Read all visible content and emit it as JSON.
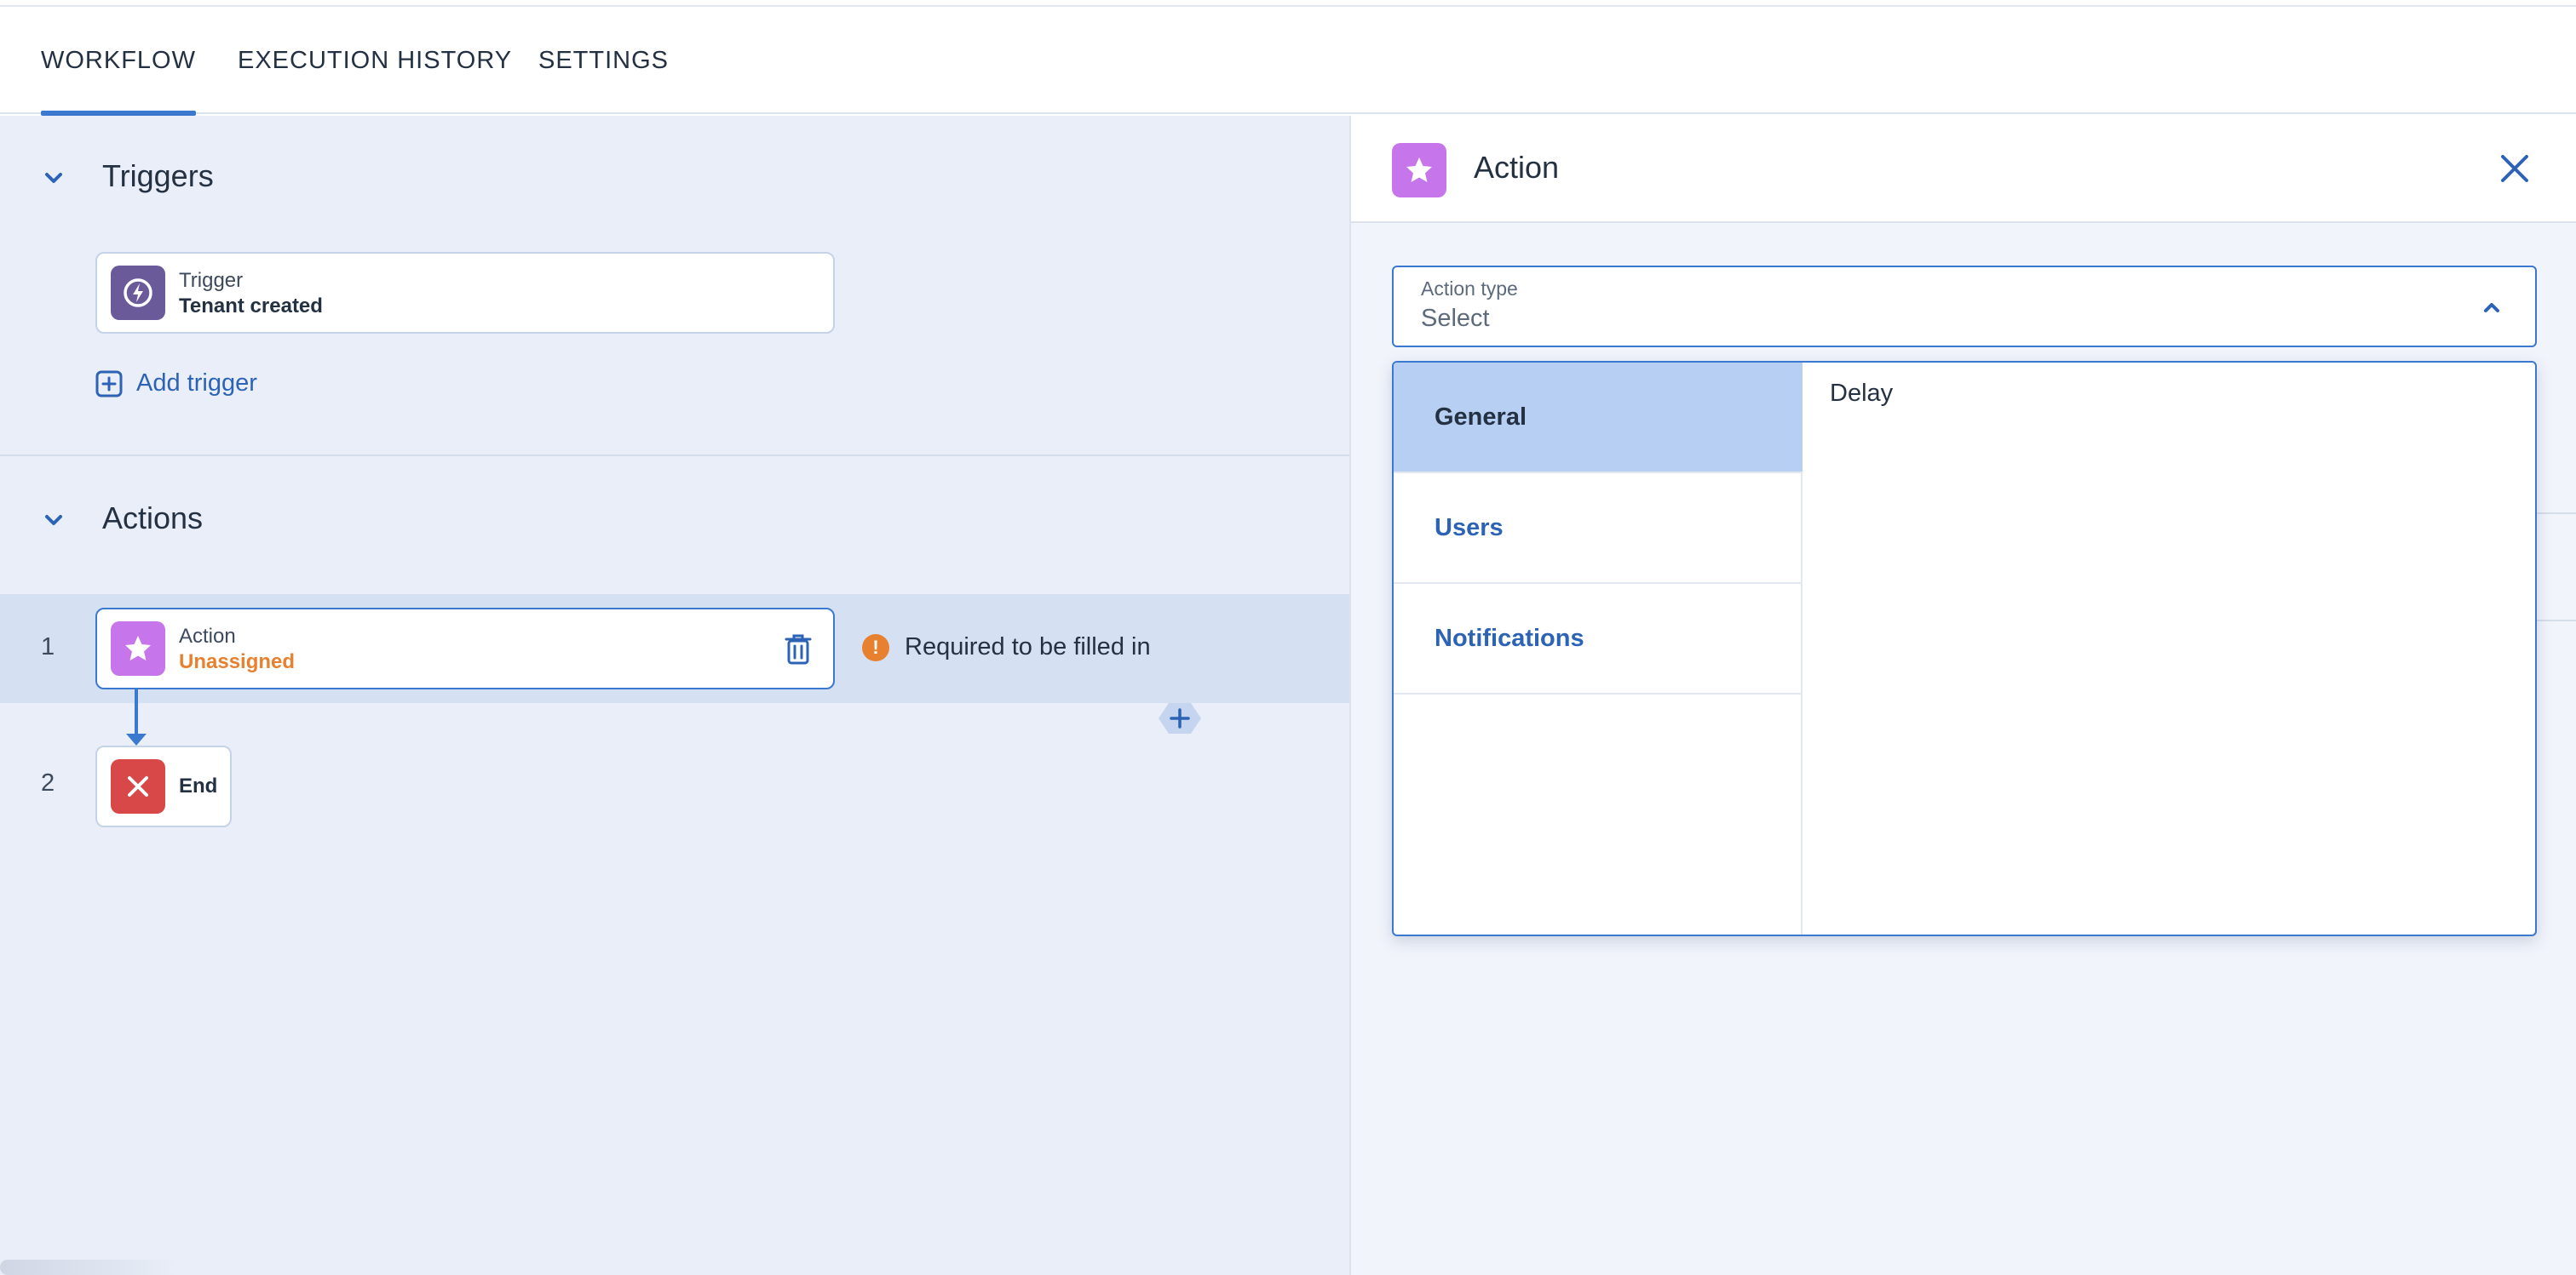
{
  "tabs": [
    {
      "label": "WORKFLOW",
      "active": true
    },
    {
      "label": "EXECUTION HISTORY",
      "active": false
    },
    {
      "label": "SETTINGS",
      "active": false
    }
  ],
  "triggers": {
    "title": "Triggers",
    "card": {
      "label": "Trigger",
      "value": "Tenant created"
    },
    "add_label": "Add trigger"
  },
  "actions": {
    "title": "Actions",
    "steps": [
      {
        "number": "1",
        "label": "Action",
        "value": "Unassigned",
        "warning": "Required to be filled in"
      },
      {
        "number": "2",
        "label": "End"
      }
    ]
  },
  "panel": {
    "title": "Action",
    "field": {
      "label": "Action type",
      "value": "Select"
    },
    "categories": [
      {
        "label": "General",
        "active": true
      },
      {
        "label": "Users",
        "active": false
      },
      {
        "label": "Notifications",
        "active": false
      }
    ],
    "options": [
      "Delay"
    ]
  },
  "colors": {
    "accent": "#3b78d0",
    "link": "#2c63b5",
    "trigger_tile": "#6a5a9a",
    "action_tile": "#c676ea",
    "end_tile": "#d94848",
    "warning": "#e8812f",
    "selected_category": "#b7cff2"
  },
  "icons": [
    "bolt-icon",
    "star-icon",
    "close-x-icon",
    "trash-icon",
    "plus-square-icon",
    "plus-icon",
    "chevron-down-icon",
    "chevron-up-icon",
    "warning-icon"
  ]
}
